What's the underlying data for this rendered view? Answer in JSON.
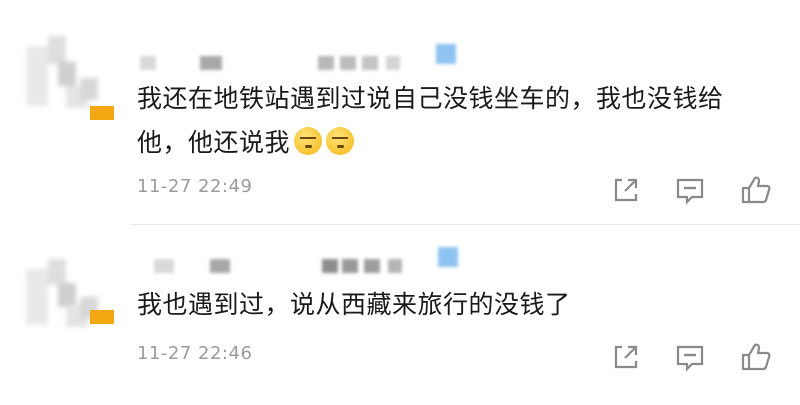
{
  "comments": [
    {
      "text": "我还在地铁站遇到过说自己没钱坐车的，我也没钱给他，他还说我",
      "emojis": [
        "smirk-emoji",
        "smirk-emoji"
      ],
      "time": "11-27 22:49"
    },
    {
      "text": "我也遇到过，说从西藏来旅行的没钱了",
      "emojis": [],
      "time": "11-27 22:46"
    }
  ],
  "icons": {
    "share": "share-icon",
    "reply": "comment-icon",
    "like": "thumbs-up-icon"
  },
  "colors": {
    "text": "#1a1a1a",
    "timestamp": "#9b9b9b",
    "icon": "#8a8a8a",
    "badge": "#f3a712",
    "verify": "#8fc3f2"
  }
}
